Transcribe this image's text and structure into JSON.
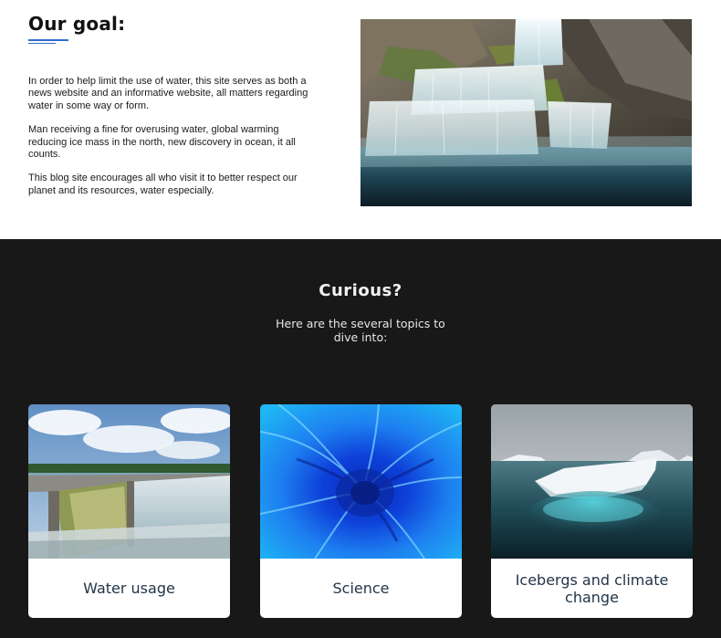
{
  "goal": {
    "title": "Our goal:",
    "paragraphs": [
      "In order to help limit the use of water, this site serves as both a news website and an informative website, all matters regarding water in some way or form.",
      "Man receiving a fine for overusing water, global warming reducing ice mass in the north, new discovery in ocean, it all counts.",
      "This blog site encourages all who visit it to better respect our planet and its resources, water especially."
    ],
    "image": "waterfall-photo",
    "accent_color": "#2f6fd6"
  },
  "topics": {
    "title": "Curious?",
    "subtitle": "Here are the several topics to dive into:",
    "background": "#181818",
    "cards": [
      {
        "label": "Water usage",
        "image": "dam-spillway-photo"
      },
      {
        "label": "Science",
        "image": "blue-ink-swirl-photo"
      },
      {
        "label": "Icebergs and climate change",
        "image": "iceberg-photo"
      }
    ]
  }
}
